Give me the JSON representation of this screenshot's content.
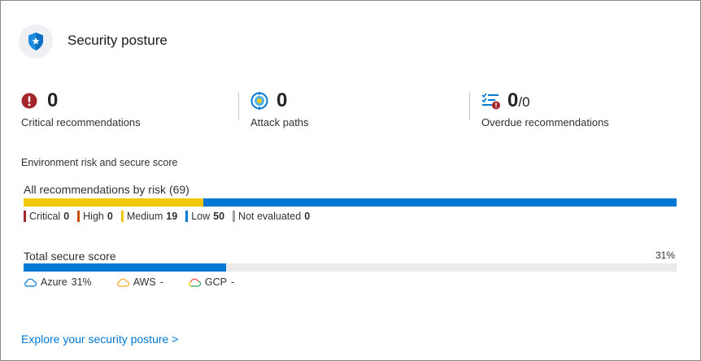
{
  "header": {
    "title": "Security posture",
    "icon": "shield-star-icon"
  },
  "metrics": [
    {
      "value": "0",
      "label": "Critical recommendations",
      "icon": "critical-alert-icon"
    },
    {
      "value": "0",
      "label": "Attack paths",
      "icon": "attack-path-icon"
    },
    {
      "value": "0",
      "denominator": "/0",
      "label": "Overdue recommendations",
      "icon": "overdue-list-icon"
    }
  ],
  "environment_label": "Environment risk and secure score",
  "risk": {
    "label": "All recommendations by risk (69)",
    "items": [
      {
        "name": "Critical",
        "count": "0",
        "color": "#a4262c"
      },
      {
        "name": "High",
        "count": "0",
        "color": "#ca5010"
      },
      {
        "name": "Medium",
        "count": "19",
        "color": "#f2c80f"
      },
      {
        "name": "Low",
        "count": "50",
        "color": "#0078d4"
      },
      {
        "name": "Not evaluated",
        "count": "0",
        "color": "#a19f9d"
      }
    ]
  },
  "score": {
    "label": "Total secure score",
    "percent_text": "31%",
    "fill_fraction": 0.31,
    "clouds": [
      {
        "name": "Azure",
        "value": "31%",
        "color": "#0078d4"
      },
      {
        "name": "AWS",
        "value": "-",
        "color": "#f7a823"
      },
      {
        "name": "GCP",
        "value": "-",
        "color": "#34a853"
      }
    ]
  },
  "colors": {
    "accent": "#0078d4",
    "track": "#edebe9"
  },
  "link": "Explore your security posture >"
}
